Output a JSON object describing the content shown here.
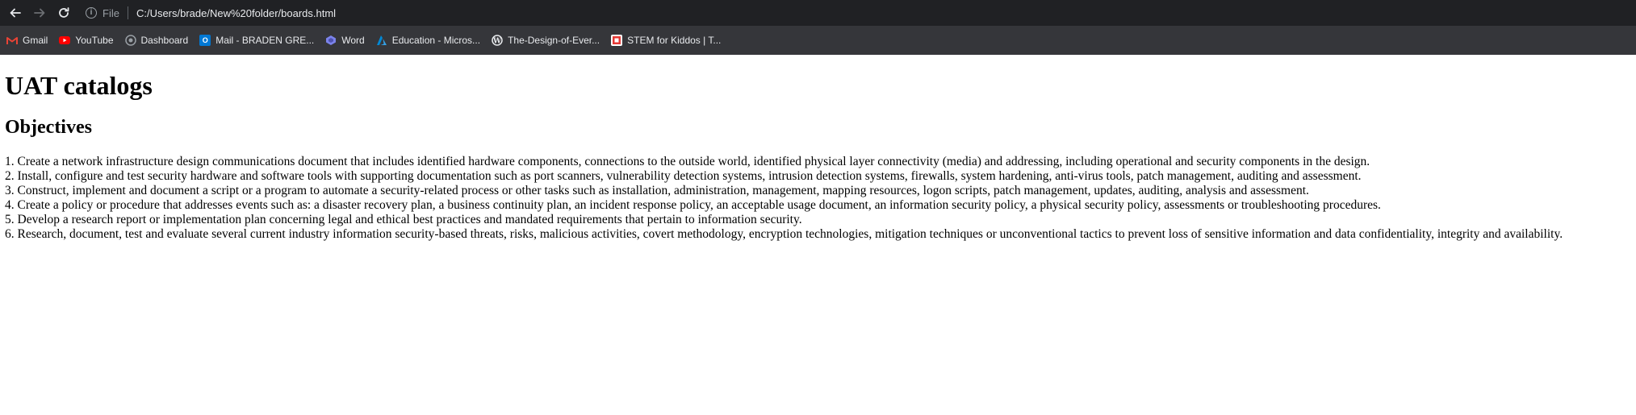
{
  "browser": {
    "security_label": "File",
    "url": "C:/Users/brade/New%20folder/boards.html",
    "info_glyph": "i"
  },
  "bookmarks": [
    {
      "label": "Gmail",
      "icon": "gmail-icon",
      "color": "#ea4335"
    },
    {
      "label": "YouTube",
      "icon": "youtube-icon",
      "color": "#ff0000"
    },
    {
      "label": "Dashboard",
      "icon": "dashboard-icon",
      "color": "#9aa0a6"
    },
    {
      "label": "Mail - BRADEN GRE...",
      "icon": "outlook-icon",
      "color": "#0078d4"
    },
    {
      "label": "Word",
      "icon": "word-icon",
      "color": "#7b83eb"
    },
    {
      "label": "Education - Micros...",
      "icon": "azure-icon",
      "color": "#0089d6"
    },
    {
      "label": "The-Design-of-Ever...",
      "icon": "wordpress-icon",
      "color": "#e8eaed"
    },
    {
      "label": "STEM for Kiddos | T...",
      "icon": "stem-icon",
      "color": "#e53935"
    }
  ],
  "page": {
    "title": "UAT catalogs",
    "subtitle": "Objectives",
    "objectives": [
      "1. Create a network infrastructure design communications document that includes identified hardware components, connections to the outside world, identified physical layer connectivity (media) and addressing, including operational and security components in the design.",
      "2. Install, configure and test security hardware and software tools with supporting documentation such as port scanners, vulnerability detection systems, intrusion detection systems, firewalls, system hardening, anti-virus tools, patch management, auditing and assessment.",
      "3. Construct, implement and document a script or a program to automate a security-related process or other tasks such as installation, administration, management, mapping resources, logon scripts, patch management, updates, auditing, analysis and assessment.",
      "4. Create a policy or procedure that addresses events such as: a disaster recovery plan, a business continuity plan, an incident response policy, an acceptable usage document, an information security policy, a physical security policy, assessments or troubleshooting procedures.",
      "5. Develop a research report or implementation plan concerning legal and ethical best practices and mandated requirements that pertain to information security.",
      "6. Research, document, test and evaluate several current industry information security-based threats, risks, malicious activities, covert methodology, encryption technologies, mitigation techniques or unconventional tactics to prevent loss of sensitive information and data confidentiality, integrity and availability."
    ]
  }
}
